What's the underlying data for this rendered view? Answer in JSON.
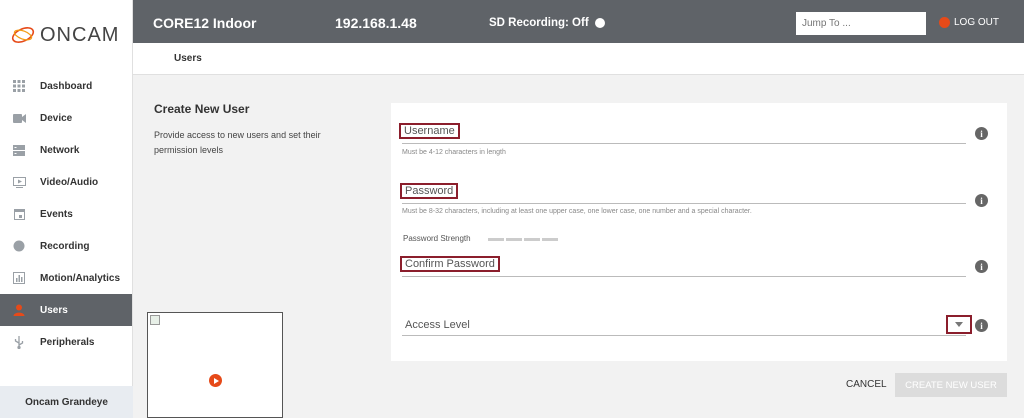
{
  "brand": {
    "name": "ONCAM"
  },
  "sidebar": {
    "items": [
      {
        "label": "Dashboard",
        "icon": "grid-icon"
      },
      {
        "label": "Device",
        "icon": "camera-icon"
      },
      {
        "label": "Network",
        "icon": "server-icon"
      },
      {
        "label": "Video/Audio",
        "icon": "video-icon"
      },
      {
        "label": "Events",
        "icon": "calendar-icon"
      },
      {
        "label": "Recording",
        "icon": "record-icon"
      },
      {
        "label": "Motion/Analytics",
        "icon": "analytics-icon"
      },
      {
        "label": "Users",
        "icon": "user-icon",
        "active": true
      },
      {
        "label": "Peripherals",
        "icon": "usb-icon"
      }
    ],
    "footer": "Oncam Grandeye"
  },
  "header": {
    "device": "CORE12 Indoor",
    "ip": "192.168.1.48",
    "sd_recording": "SD Recording: Off",
    "jump_placeholder": "Jump To ...",
    "logout": "LOG OUT"
  },
  "breadcrumb": "Users",
  "section": {
    "title": "Create New User",
    "description": "Provide access to new users and set their permission levels"
  },
  "form": {
    "username_label": "Username",
    "username_hint": "Must be 4-12 characters in length",
    "password_label": "Password",
    "password_hint": "Must be 8-32 characters, including at least one upper case, one lower case, one number and a special character.",
    "strength_label": "Password Strength",
    "confirm_label": "Confirm Password",
    "access_label": "Access Level",
    "info_glyph": "i"
  },
  "actions": {
    "cancel": "CANCEL",
    "create": "CREATE NEW USER"
  },
  "colors": {
    "header_bg": "#5f6368",
    "accent": "#e64a19",
    "highlight_border": "#8b1e2c"
  }
}
